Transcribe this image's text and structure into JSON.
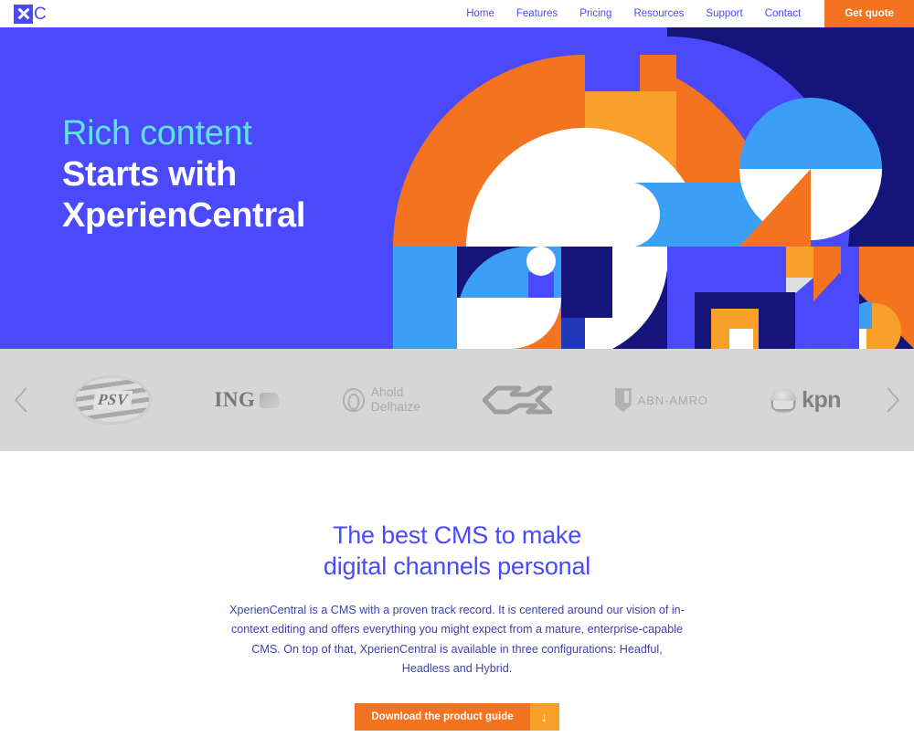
{
  "brand": {
    "mark_icon": "x-logo-icon",
    "wordmark": "C"
  },
  "nav": {
    "items": [
      {
        "label": "Home"
      },
      {
        "label": "Features"
      },
      {
        "label": "Pricing"
      },
      {
        "label": "Resources"
      },
      {
        "label": "Support"
      },
      {
        "label": "Contact"
      }
    ],
    "cta_label": "Get quote"
  },
  "hero": {
    "line1": "Rich content",
    "line2": "Starts with",
    "line3": "XperienCentral",
    "bg_color": "#4a4afc",
    "accent_color": "#5fe3e0",
    "art_colors": [
      "#4a4afc",
      "#f47320",
      "#f8a029",
      "#3ba0f5",
      "#14147a",
      "#ffffff",
      "#2039b8"
    ]
  },
  "logos": {
    "prev_icon": "chevron-left-icon",
    "next_icon": "chevron-right-icon",
    "bg_color": "#d6d6d6",
    "items": [
      {
        "name": "PSV",
        "text": "PSV"
      },
      {
        "name": "ING",
        "text": "ING"
      },
      {
        "name": "Ahold Delhaize",
        "line1": "Ahold",
        "line2": "Delhaize"
      },
      {
        "name": "NS",
        "text": ""
      },
      {
        "name": "ABN AMRO",
        "text": "ABN·AMRO"
      },
      {
        "name": "KPN",
        "text": "kpn"
      }
    ]
  },
  "main": {
    "title_line1": "The best CMS to make",
    "title_line2": "digital channels personal",
    "paragraph": "XperienCentral is a CMS with a proven track record. It is centered around our vision of in-context editing and offers everything you might expect from a mature, enterprise-capable CMS. On top of that, XperienCentral is available in three configurations: Headful, Headless and Hybrid.",
    "download_label": "Download the product guide",
    "download_icon": "arrow-down-icon",
    "title_color": "#4a4afc",
    "button_color": "#f47320"
  }
}
